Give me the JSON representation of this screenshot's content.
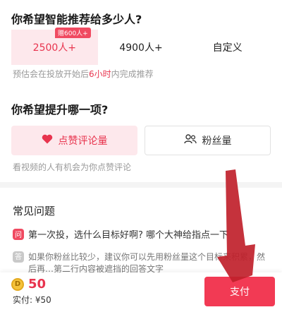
{
  "audience": {
    "title": "你希望智能推荐给多少人?",
    "options": [
      {
        "label": "2500人+",
        "badge": "赠600人+",
        "selected": true
      },
      {
        "label": "4900人+",
        "selected": false
      },
      {
        "label": "自定义",
        "selected": false
      }
    ],
    "hint_prefix": "预估会在投放开始后",
    "hint_highlight": "6小时",
    "hint_suffix": "内完成推荐"
  },
  "boost": {
    "title": "你希望提升哪一项?",
    "options": [
      {
        "label": "点赞评论量",
        "icon": "heart-icon",
        "selected": true
      },
      {
        "label": "粉丝量",
        "icon": "users-icon",
        "selected": false
      }
    ],
    "hint": "看视频的人有机会为你点赞评论"
  },
  "faq": {
    "title": "常见问题",
    "q_mark": "问",
    "question": "第一次投，选什么目标好啊? 哪个大神给指点一下",
    "a_mark": "答",
    "answer": "如果你粉丝比较少，建议你可以先用粉丝量这个目标来积累，然后再…第二行内容被遮挡的回答文字"
  },
  "footer": {
    "coin_value": "50",
    "paid_label": "实付: ¥50",
    "pay_button": "支付"
  },
  "colors": {
    "accent": "#f23a54",
    "accent_light": "#fde8ec",
    "arrow": "#c0212b"
  }
}
